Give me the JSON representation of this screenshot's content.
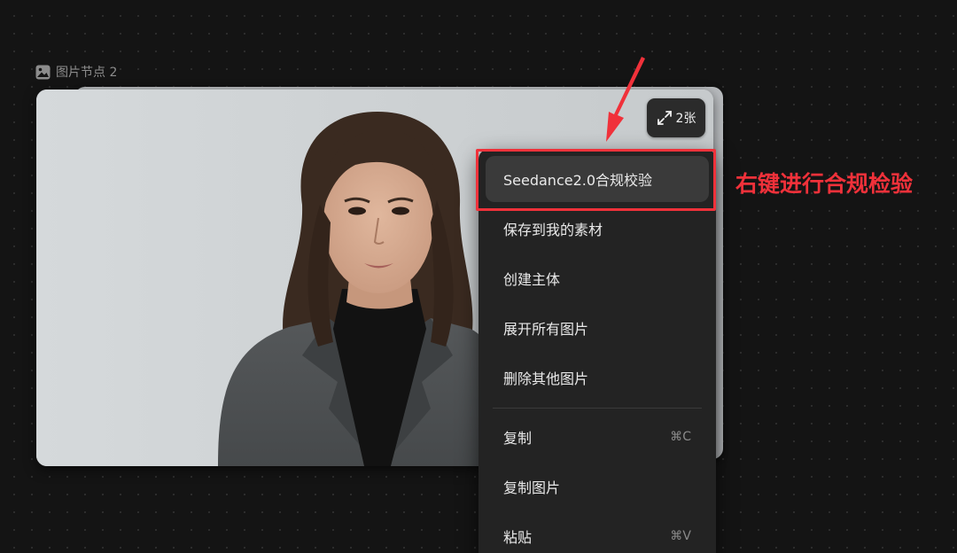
{
  "node": {
    "icon": "image-icon",
    "label": "图片节点 2"
  },
  "badge": {
    "icon": "expand-icon",
    "label": "2张"
  },
  "context_menu": {
    "items": [
      {
        "label": "Seedance2.0合规校验",
        "shortcut": "",
        "active": true
      },
      {
        "label": "保存到我的素材",
        "shortcut": ""
      },
      {
        "label": "创建主体",
        "shortcut": ""
      },
      {
        "label": "展开所有图片",
        "shortcut": ""
      },
      {
        "label": "删除其他图片",
        "shortcut": ""
      },
      {
        "label": "复制",
        "shortcut": "⌘C"
      },
      {
        "label": "复制图片",
        "shortcut": ""
      },
      {
        "label": "粘贴",
        "shortcut": "⌘V"
      }
    ]
  },
  "annotation": {
    "text": "右键进行合规检验",
    "color": "#f0313a"
  },
  "colors": {
    "canvas_bg": "#141414",
    "menu_bg": "#232323",
    "menu_active": "#3a3a3a",
    "accent_red": "#f0313a"
  }
}
